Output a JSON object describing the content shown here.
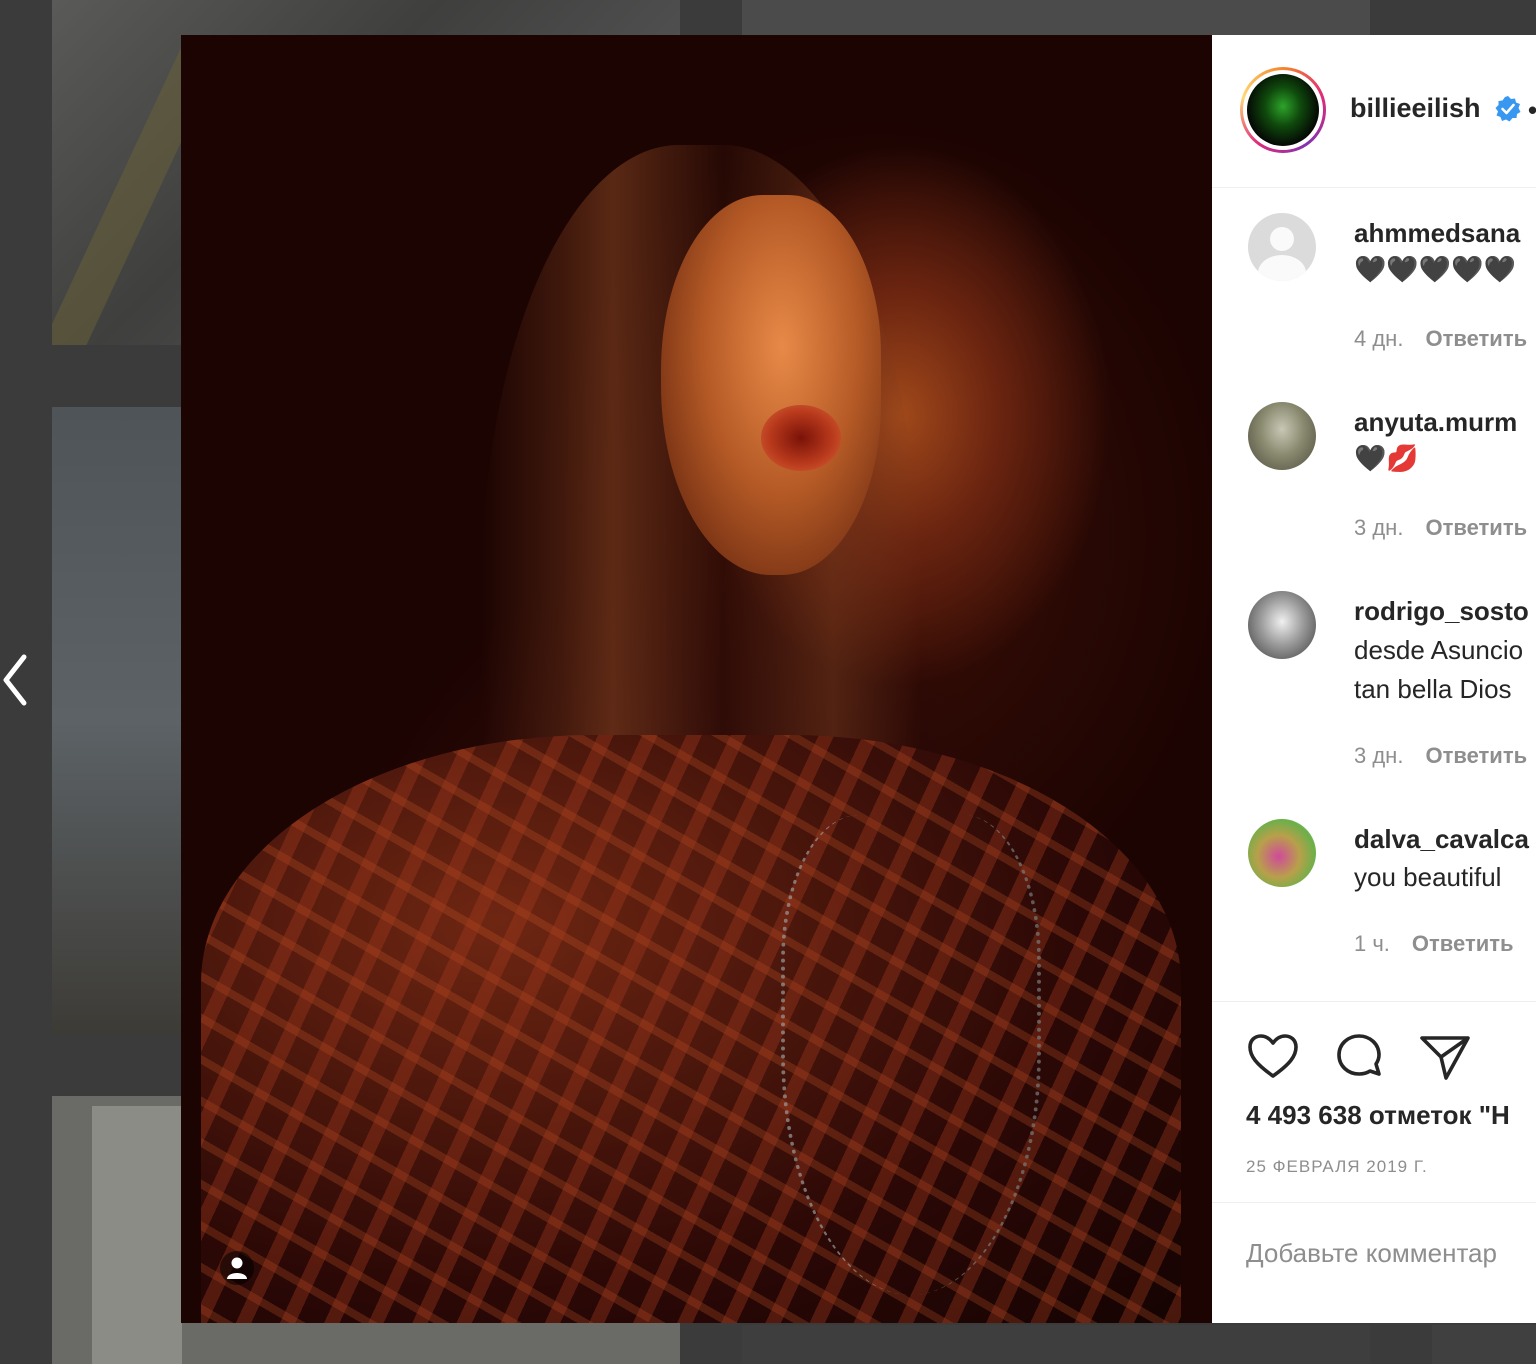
{
  "post": {
    "author": "billieeilish",
    "verified_icon": "verified-badge-icon",
    "header_separator": "•"
  },
  "comments": [
    {
      "username": "ahmmedsana",
      "text": "🖤🖤🖤🖤🖤",
      "time": "4 дн.",
      "reply": "Ответить"
    },
    {
      "username": "anyuta.murm",
      "text": "🖤💋",
      "time": "3 дн.",
      "reply": "Ответить"
    },
    {
      "username": "rodrigo_sosto",
      "text_line1": "desde Asuncio",
      "text_line2": "tan bella Dios",
      "time": "3 дн.",
      "reply": "Ответить"
    },
    {
      "username": "dalva_cavalca",
      "text": "you beautiful",
      "time": "1 ч.",
      "reply": "Ответить"
    }
  ],
  "actions": {
    "like_icon": "heart-outline-icon",
    "comment_icon": "comment-bubble-icon",
    "share_icon": "paper-plane-icon"
  },
  "likes_text": "4 493 638 отметок \"Н",
  "date": "25 ФЕВРАЛЯ 2019 Г.",
  "add_comment": {
    "placeholder": "Добавьте комментар"
  },
  "colors": {
    "accent_verified": "#3897f0",
    "text_primary": "#262626",
    "text_secondary": "#8e8e8e",
    "overlay": "#3b3b3b"
  }
}
